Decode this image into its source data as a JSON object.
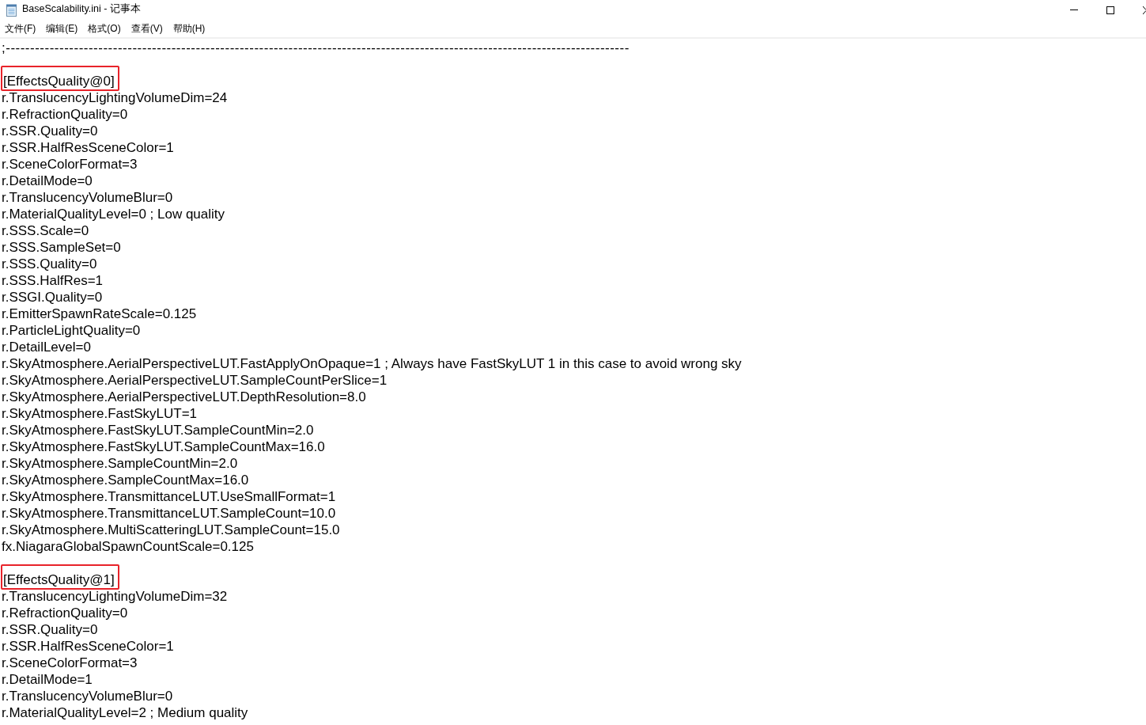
{
  "window": {
    "title": "BaseScalability.ini - 记事本"
  },
  "menu": [
    "文件(F)",
    "编辑(E)",
    "格式(O)",
    "查看(V)",
    "帮助(H)"
  ],
  "editor": {
    "comment": ";--------------------------------------------------------------------------------------------------------------------------------",
    "sections": [
      {
        "header": "[EffectsQuality@0]",
        "marked": true,
        "lines": [
          "r.TranslucencyLightingVolumeDim=24",
          "r.RefractionQuality=0",
          "r.SSR.Quality=0",
          "r.SSR.HalfResSceneColor=1",
          "r.SceneColorFormat=3",
          "r.DetailMode=0",
          "r.TranslucencyVolumeBlur=0",
          "r.MaterialQualityLevel=0 ; Low quality",
          "r.SSS.Scale=0",
          "r.SSS.SampleSet=0",
          "r.SSS.Quality=0",
          "r.SSS.HalfRes=1",
          "r.SSGI.Quality=0",
          "r.EmitterSpawnRateScale=0.125",
          "r.ParticleLightQuality=0",
          "r.DetailLevel=0",
          "r.SkyAtmosphere.AerialPerspectiveLUT.FastApplyOnOpaque=1 ; Always have FastSkyLUT 1 in this case to avoid wrong sky",
          "r.SkyAtmosphere.AerialPerspectiveLUT.SampleCountPerSlice=1",
          "r.SkyAtmosphere.AerialPerspectiveLUT.DepthResolution=8.0",
          "r.SkyAtmosphere.FastSkyLUT=1",
          "r.SkyAtmosphere.FastSkyLUT.SampleCountMin=2.0",
          "r.SkyAtmosphere.FastSkyLUT.SampleCountMax=16.0",
          "r.SkyAtmosphere.SampleCountMin=2.0",
          "r.SkyAtmosphere.SampleCountMax=16.0",
          "r.SkyAtmosphere.TransmittanceLUT.UseSmallFormat=1",
          "r.SkyAtmosphere.TransmittanceLUT.SampleCount=10.0",
          "r.SkyAtmosphere.MultiScatteringLUT.SampleCount=15.0",
          "fx.NiagaraGlobalSpawnCountScale=0.125"
        ]
      },
      {
        "header": "[EffectsQuality@1]",
        "marked": true,
        "lines": [
          "r.TranslucencyLightingVolumeDim=32",
          "r.RefractionQuality=0",
          "r.SSR.Quality=0",
          "r.SSR.HalfResSceneColor=1",
          "r.SceneColorFormat=3",
          "r.DetailMode=1",
          "r.TranslucencyVolumeBlur=0",
          "r.MaterialQualityLevel=2 ; Medium quality"
        ]
      }
    ]
  }
}
